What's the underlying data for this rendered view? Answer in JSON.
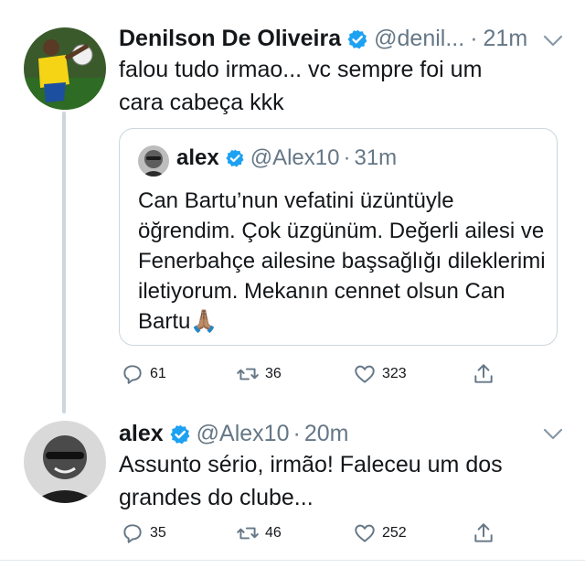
{
  "tweets": [
    {
      "name": "Denilson De Oliveira",
      "handle": "@denil...",
      "time": "21m",
      "text": "falou tudo irmao... vc sempre foi um cara cabeça kkk",
      "quote": {
        "name": "alex",
        "handle": "@Alex10",
        "time": "31m",
        "text": "Can Bartu’nun vefatini üzüntüyle öğrendim. Çok üzgünüm. Değerli ailesi ve Fenerbahçe ailesine başsağlığı dileklerimi iletiyorum. Mekanın cennet olsun Can Bartu🙏🏽"
      },
      "replies": "61",
      "retweets": "36",
      "likes": "323"
    },
    {
      "name": "alex",
      "handle": "@Alex10",
      "time": "20m",
      "text": "Assunto sério, irmão! Faleceu um dos grandes do clube...",
      "replies": "35",
      "retweets": "46",
      "likes": "252"
    }
  ],
  "colors": {
    "verified": "#1da1f2",
    "muted": "#657786",
    "border": "#ccd6dd"
  },
  "icons": [
    "verified-badge-icon",
    "chevron-down-icon",
    "reply-icon",
    "retweet-icon",
    "like-icon",
    "share-icon"
  ]
}
